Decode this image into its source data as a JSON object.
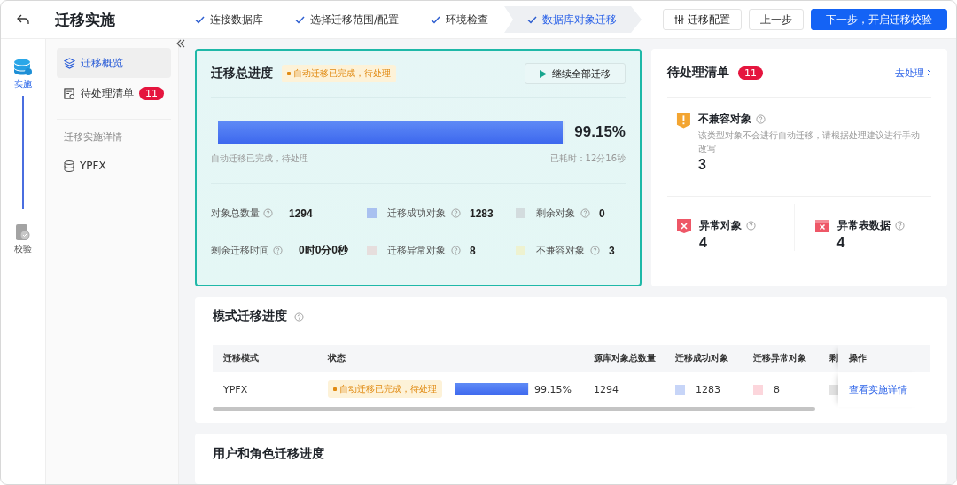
{
  "header": {
    "title": "迁移实施",
    "steps": [
      {
        "label": "连接数据库",
        "selected": false
      },
      {
        "label": "选择迁移范围/配置",
        "selected": false
      },
      {
        "label": "环境检查",
        "selected": false
      },
      {
        "label": "数据库对象迁移",
        "selected": true
      }
    ],
    "buttons": [
      {
        "label": "迁移配置",
        "kind": "config"
      },
      {
        "label": "上一步",
        "kind": "default"
      },
      {
        "label": "下一步，开启迁移校验",
        "kind": "primary"
      }
    ]
  },
  "rail": [
    {
      "label": "实施",
      "selected": true
    },
    {
      "label": "校验",
      "selected": false
    }
  ],
  "sidebar": {
    "items": [
      {
        "label": "迁移概览",
        "selected": true,
        "kind": "overview"
      },
      {
        "label": "待处理清单",
        "selected": false,
        "kind": "todo",
        "badge": "11"
      }
    ],
    "section": "迁移实施详情",
    "schemas": [
      "YPFX"
    ]
  },
  "progress": {
    "title": "迁移总进度",
    "status": "自动迁移已完成，待处理",
    "action": "继续全部迁移",
    "level": 0.9915,
    "percent": "99.15%",
    "caption": "自动迁移已完成，待处理",
    "elapsed": "已耗时：12分16秒",
    "stats": [
      {
        "label": "对象总数量",
        "value": "1294"
      },
      {
        "label": "迁移成功对象",
        "value": "1283",
        "color": "#a9c1f0"
      },
      {
        "label": "剩余对象",
        "value": "0",
        "color": "#d3dcde"
      },
      {
        "label": "剩余迁移时间",
        "value": "0时0分0秒"
      },
      {
        "label": "迁移异常对象",
        "value": "8",
        "color": "#e6dedd"
      },
      {
        "label": "不兼容对象",
        "value": "3",
        "color": "#eef2d0"
      }
    ]
  },
  "pending": {
    "title": "待处理清单",
    "count": "11",
    "link": "去处理",
    "items": [
      {
        "kind": "warning",
        "label": "不兼容对象",
        "desc": "该类型对象不会进行自动迁移，请根据处理建议进行手动改写",
        "value": "3"
      },
      {
        "kind": "error",
        "label": "异常对象",
        "value": "4"
      },
      {
        "kind": "table-error",
        "label": "异常表数据",
        "value": "4"
      }
    ]
  },
  "schema_progress": {
    "title": "模式迁移进度",
    "table": {
      "columns": [
        "迁移模式",
        "状态",
        "源库对象总数量",
        "迁移成功对象",
        "迁移异常对象",
        "剩",
        "操作"
      ],
      "rows": [
        {
          "schema": "YPFX",
          "status": "自动迁移已完成，待处理",
          "level": 0.9915,
          "percent": "99.15%",
          "total": "1294",
          "success": {
            "text": "1283",
            "color": "#c7d5f8"
          },
          "error": {
            "text": "8",
            "color": "#fcd6dc"
          },
          "remaining": {
            "color": "#e2e2e2"
          },
          "action": "查看实施详情"
        }
      ]
    }
  },
  "user_progress": {
    "title": "用户和角色迁移进度"
  }
}
